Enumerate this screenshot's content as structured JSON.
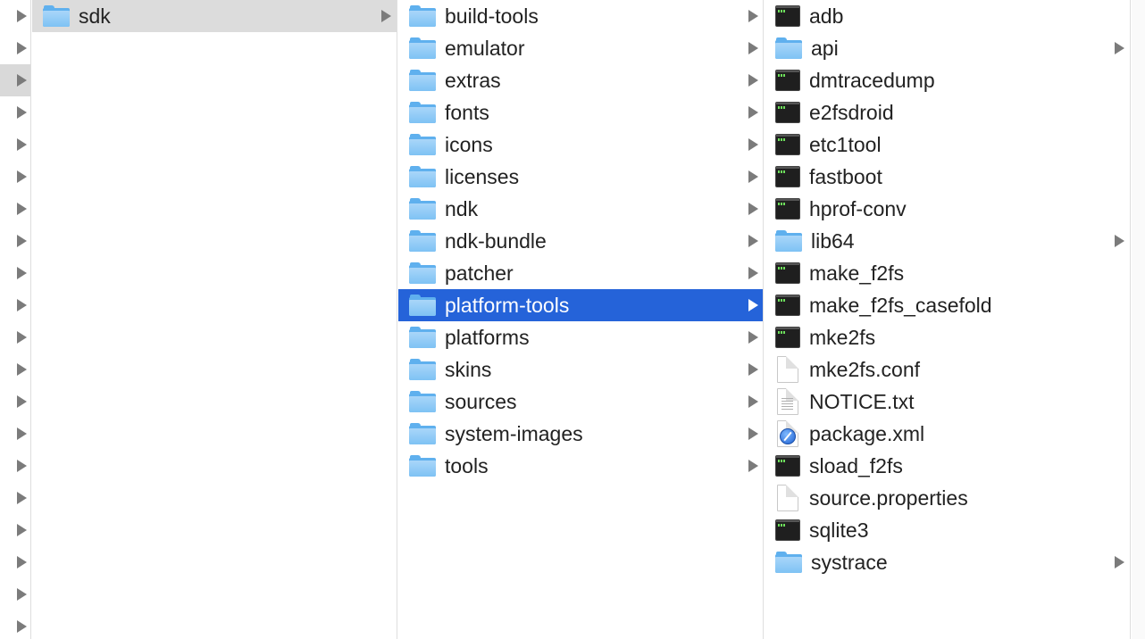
{
  "left_strip": {
    "rows": 20,
    "highlighted_row": 2
  },
  "column_sdk": {
    "items": [
      {
        "label": "sdk",
        "kind": "folder",
        "has_children": true,
        "selected": true
      }
    ]
  },
  "column_sdk_contents": {
    "items": [
      {
        "label": "build-tools",
        "kind": "folder",
        "has_children": true
      },
      {
        "label": "emulator",
        "kind": "folder",
        "has_children": true
      },
      {
        "label": "extras",
        "kind": "folder",
        "has_children": true
      },
      {
        "label": "fonts",
        "kind": "folder",
        "has_children": true
      },
      {
        "label": "icons",
        "kind": "folder",
        "has_children": true
      },
      {
        "label": "licenses",
        "kind": "folder",
        "has_children": true
      },
      {
        "label": "ndk",
        "kind": "folder",
        "has_children": true
      },
      {
        "label": "ndk-bundle",
        "kind": "folder",
        "has_children": true
      },
      {
        "label": "patcher",
        "kind": "folder",
        "has_children": true
      },
      {
        "label": "platform-tools",
        "kind": "folder",
        "has_children": true,
        "selected": true
      },
      {
        "label": "platforms",
        "kind": "folder",
        "has_children": true
      },
      {
        "label": "skins",
        "kind": "folder",
        "has_children": true
      },
      {
        "label": "sources",
        "kind": "folder",
        "has_children": true
      },
      {
        "label": "system-images",
        "kind": "folder",
        "has_children": true
      },
      {
        "label": "tools",
        "kind": "folder",
        "has_children": true
      }
    ]
  },
  "column_platform_tools": {
    "items": [
      {
        "label": "adb",
        "kind": "exec",
        "has_children": false
      },
      {
        "label": "api",
        "kind": "folder",
        "has_children": true
      },
      {
        "label": "dmtracedump",
        "kind": "exec",
        "has_children": false
      },
      {
        "label": "e2fsdroid",
        "kind": "exec",
        "has_children": false
      },
      {
        "label": "etc1tool",
        "kind": "exec",
        "has_children": false
      },
      {
        "label": "fastboot",
        "kind": "exec",
        "has_children": false
      },
      {
        "label": "hprof-conv",
        "kind": "exec",
        "has_children": false
      },
      {
        "label": "lib64",
        "kind": "folder",
        "has_children": true
      },
      {
        "label": "make_f2fs",
        "kind": "exec",
        "has_children": false
      },
      {
        "label": "make_f2fs_casefold",
        "kind": "exec",
        "has_children": false
      },
      {
        "label": "mke2fs",
        "kind": "exec",
        "has_children": false
      },
      {
        "label": "mke2fs.conf",
        "kind": "doc",
        "has_children": false
      },
      {
        "label": "NOTICE.txt",
        "kind": "text",
        "has_children": false
      },
      {
        "label": "package.xml",
        "kind": "xml",
        "has_children": false
      },
      {
        "label": "sload_f2fs",
        "kind": "exec",
        "has_children": false
      },
      {
        "label": "source.properties",
        "kind": "doc",
        "has_children": false
      },
      {
        "label": "sqlite3",
        "kind": "exec",
        "has_children": false
      },
      {
        "label": "systrace",
        "kind": "folder",
        "has_children": true
      }
    ]
  },
  "colors": {
    "selection_active": "#2563d9",
    "selection_inactive": "#dcdcdc",
    "folder": "#7ec2f4"
  }
}
